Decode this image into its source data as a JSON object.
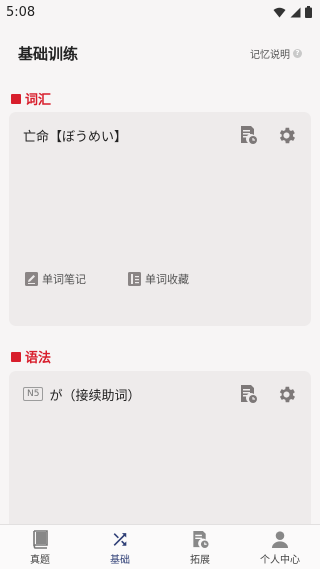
{
  "status_bar": {
    "time": "5:08"
  },
  "header": {
    "title": "基础训练",
    "memory_link": "记忆说明"
  },
  "vocab": {
    "section_label": "词汇",
    "card_title": "亡命【ぼうめい】",
    "footer": {
      "notes_label": "单词笔记",
      "favorites_label": "单词收藏"
    }
  },
  "grammar": {
    "section_label": "语法",
    "level_badge": "N5",
    "card_title": "が（接续助词）"
  },
  "tabs": [
    {
      "label": "真题",
      "icon": "book-icon",
      "active": false
    },
    {
      "label": "基础",
      "icon": "shuffle-icon",
      "active": true
    },
    {
      "label": "拓展",
      "icon": "document-clock-icon",
      "active": false
    },
    {
      "label": "个人中心",
      "icon": "person-icon",
      "active": false
    }
  ],
  "colors": {
    "accent_red": "#d81e2c",
    "active_tab": "#2f3f76",
    "icon_gray": "#7d7878"
  }
}
